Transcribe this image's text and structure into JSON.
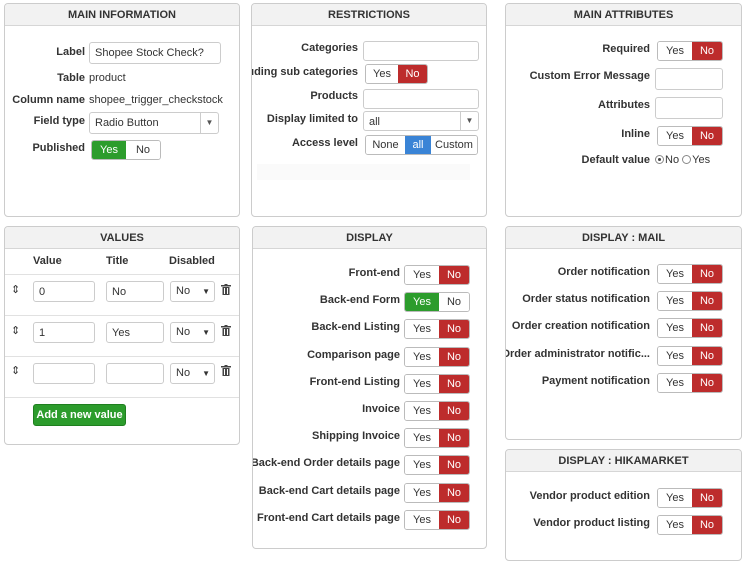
{
  "main_info": {
    "title": "MAIN INFORMATION",
    "label_label": "Label",
    "label_value": "Shopee Stock Check?",
    "table_label": "Table",
    "table_value": "product",
    "column_label": "Column name",
    "column_value": "shopee_trigger_checkstock",
    "fieldtype_label": "Field type",
    "fieldtype_value": "Radio Button",
    "published_label": "Published",
    "published_yes": "Yes",
    "published_no": "No",
    "published_selected": "Yes"
  },
  "restrictions": {
    "title": "RESTRICTIONS",
    "categories_label": "Categories",
    "categories_value": "",
    "subcat_label": "Including sub categories",
    "subcat_yes": "Yes",
    "subcat_no": "No",
    "subcat_selected": "No",
    "products_label": "Products",
    "products_value": "",
    "display_limited_label": "Display limited to",
    "display_limited_value": "all",
    "access_label": "Access level",
    "access_options": [
      "None",
      "all",
      "Custom"
    ],
    "access_selected": "all"
  },
  "main_attributes": {
    "title": "MAIN ATTRIBUTES",
    "required_label": "Required",
    "required_yes": "Yes",
    "required_no": "No",
    "required_selected": "No",
    "custom_error_label": "Custom Error Message",
    "custom_error_value": "",
    "attributes_label": "Attributes",
    "attributes_value": "",
    "inline_label": "Inline",
    "inline_yes": "Yes",
    "inline_no": "No",
    "inline_selected": "No",
    "default_label": "Default value",
    "default_no": "No",
    "default_yes": "Yes",
    "default_selected": "No"
  },
  "values": {
    "title": "VALUES",
    "col_value": "Value",
    "col_title": "Title",
    "col_disabled": "Disabled",
    "rows": [
      {
        "value": "0",
        "title": "No",
        "disabled": "No"
      },
      {
        "value": "1",
        "title": "Yes",
        "disabled": "No"
      },
      {
        "value": "",
        "title": "",
        "disabled": "No"
      }
    ],
    "add_button": "Add a new value"
  },
  "display": {
    "title": "DISPLAY",
    "yes": "Yes",
    "no": "No",
    "items": [
      {
        "label": "Front-end",
        "selected": "No"
      },
      {
        "label": "Back-end Form",
        "selected": "Yes"
      },
      {
        "label": "Back-end Listing",
        "selected": "No"
      },
      {
        "label": "Comparison page",
        "selected": "No"
      },
      {
        "label": "Front-end Listing",
        "selected": "No"
      },
      {
        "label": "Invoice",
        "selected": "No"
      },
      {
        "label": "Shipping Invoice",
        "selected": "No"
      },
      {
        "label": "Back-end Order details page",
        "selected": "No"
      },
      {
        "label": "Back-end Cart details page",
        "selected": "No"
      },
      {
        "label": "Front-end Cart details page",
        "selected": "No"
      }
    ]
  },
  "display_mail": {
    "title": "DISPLAY : MAIL",
    "yes": "Yes",
    "no": "No",
    "items": [
      {
        "label": "Order notification",
        "selected": "No"
      },
      {
        "label": "Order status notification",
        "selected": "No"
      },
      {
        "label": "Order creation notification",
        "selected": "No"
      },
      {
        "label": "Order administrator notific...",
        "selected": "No"
      },
      {
        "label": "Payment notification",
        "selected": "No"
      }
    ]
  },
  "display_hikamarket": {
    "title": "DISPLAY : HIKAMARKET",
    "yes": "Yes",
    "no": "No",
    "items": [
      {
        "label": "Vendor product edition",
        "selected": "No"
      },
      {
        "label": "Vendor product listing",
        "selected": "No"
      }
    ]
  },
  "colors": {
    "red": "#bd2c2c",
    "green": "#2c9c2c",
    "blue": "#3a84d6"
  },
  "icons": {
    "move": "move-vertical-icon",
    "delete": "trash-icon",
    "dropdown": "caret-down-icon"
  }
}
